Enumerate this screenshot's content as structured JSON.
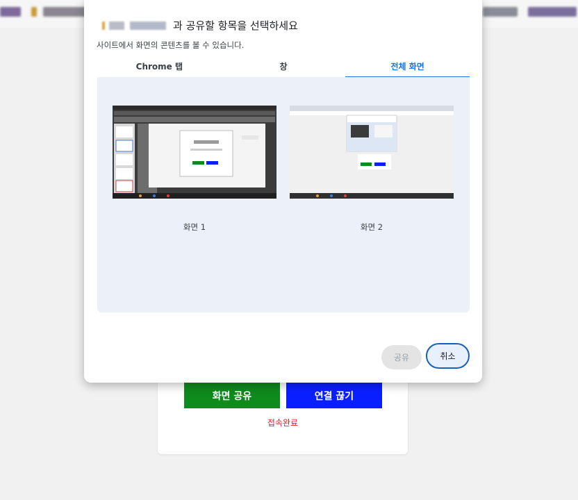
{
  "dialog": {
    "title_suffix": "과 공유할 항목을 선택하세요",
    "subtitle": "사이트에서 화면의 콘텐츠를 볼 수 있습니다.",
    "tabs": [
      {
        "label": "Chrome 탭"
      },
      {
        "label": "창"
      },
      {
        "label": "전체 화면",
        "active": true
      }
    ],
    "screens": [
      {
        "label": "화면 1"
      },
      {
        "label": "화면 2"
      }
    ],
    "share_label": "공유",
    "cancel_label": "취소"
  },
  "page": {
    "share_screen_label": "화면 공유",
    "disconnect_label": "연결 끊기",
    "status_text": "접속완료"
  },
  "colors": {
    "accent": "#1a73e8",
    "share_green": "#0f8a1d",
    "disconnect_blue": "#0a1fff",
    "status_red": "#e01b1b"
  }
}
